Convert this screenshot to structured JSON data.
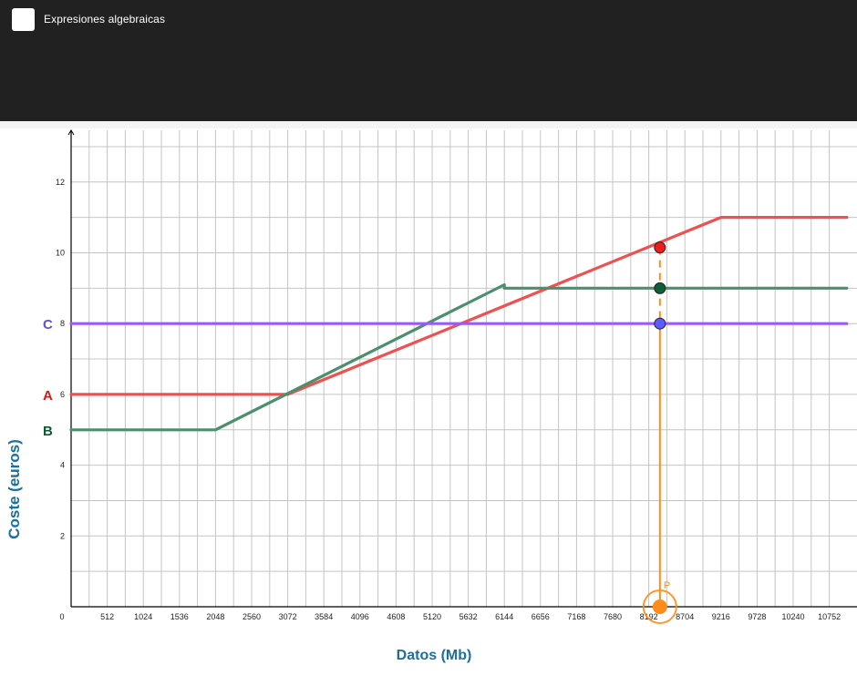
{
  "app": {
    "title": "Expresiones algebraicas",
    "logo_icon": "app-logo-icon"
  },
  "chart_data": {
    "type": "line",
    "xlabel": "Datos (Mb)",
    "ylabel": "Coste (euros)",
    "xlim": [
      0,
      11000
    ],
    "ylim": [
      0,
      13.5
    ],
    "x_ticks": [
      "0",
      "512",
      "1024",
      "1536",
      "2048",
      "2560",
      "3072",
      "3584",
      "4096",
      "4608",
      "5120",
      "5632",
      "6144",
      "6656",
      "7168",
      "7680",
      "8192",
      "8704",
      "9216",
      "9728",
      "10240",
      "10752"
    ],
    "y_ticks": [
      "2",
      "4",
      "6",
      "8",
      "10",
      "12"
    ],
    "grid": true,
    "series": [
      {
        "name": "A",
        "color": "#f05050",
        "points": [
          [
            0,
            6
          ],
          [
            3072,
            6
          ],
          [
            9216,
            11
          ],
          [
            11000,
            11
          ]
        ]
      },
      {
        "name": "B",
        "color": "#4b8f6c",
        "points": [
          [
            0,
            5
          ],
          [
            2048,
            5
          ],
          [
            6144,
            9.1
          ],
          [
            6144,
            9
          ],
          [
            11000,
            9
          ]
        ]
      },
      {
        "name": "C",
        "color": "#9a5cf0",
        "points": [
          [
            0,
            8
          ],
          [
            11000,
            8
          ]
        ]
      }
    ],
    "series_label_colors": {
      "A": "#e01414",
      "B": "#0c5a32",
      "C": "#5a4fe6"
    },
    "point_p": {
      "label": "P",
      "x": 8350,
      "y": 0,
      "color": "#ff8c1a"
    },
    "intersections": [
      {
        "series": "A",
        "x": 8350,
        "y": 10.15,
        "color": "#ee1c1c"
      },
      {
        "series": "B",
        "x": 8350,
        "y": 9,
        "color": "#0f5f35"
      },
      {
        "series": "C",
        "x": 8350,
        "y": 8,
        "color": "#5b5bff"
      }
    ]
  }
}
